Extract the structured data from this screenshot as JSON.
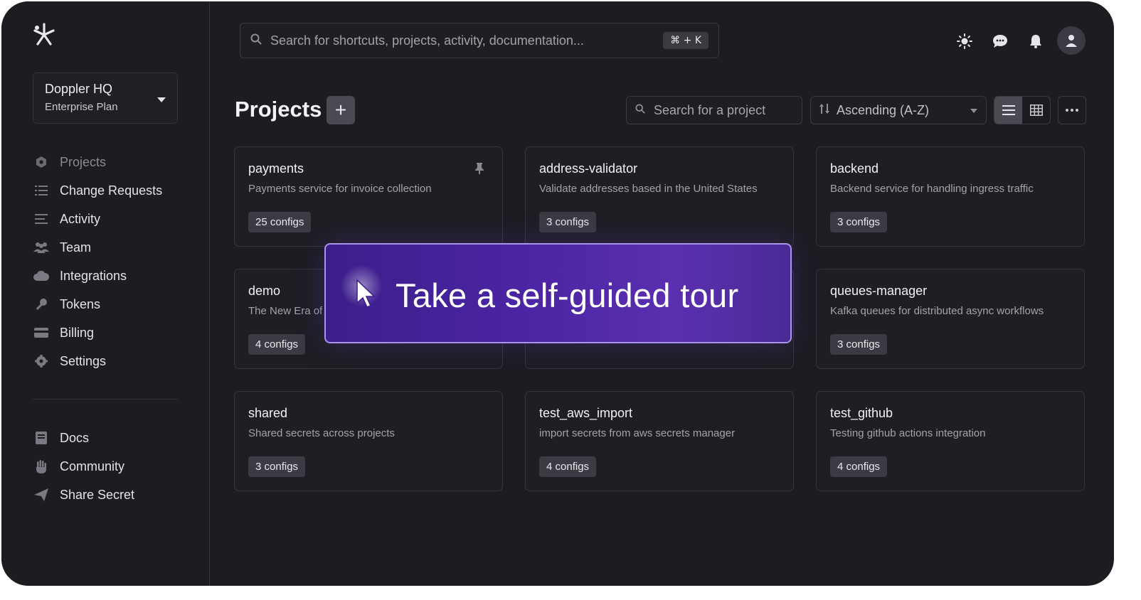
{
  "org": {
    "name": "Doppler HQ",
    "plan": "Enterprise Plan"
  },
  "sidebar": {
    "items": [
      {
        "label": "Projects",
        "icon": "hexagon-gear-icon"
      },
      {
        "label": "Change Requests",
        "icon": "list-check-icon"
      },
      {
        "label": "Activity",
        "icon": "lines-icon"
      },
      {
        "label": "Team",
        "icon": "users-icon"
      },
      {
        "label": "Integrations",
        "icon": "cloud-icon"
      },
      {
        "label": "Tokens",
        "icon": "key-icon"
      },
      {
        "label": "Billing",
        "icon": "credit-card-icon"
      },
      {
        "label": "Settings",
        "icon": "gear-icon"
      }
    ],
    "footer_items": [
      {
        "label": "Docs",
        "icon": "book-icon"
      },
      {
        "label": "Community",
        "icon": "hand-icon"
      },
      {
        "label": "Share Secret",
        "icon": "paper-plane-icon"
      }
    ]
  },
  "search": {
    "placeholder": "Search for shortcuts, projects, activity, documentation...",
    "shortcut": "⌘ + K"
  },
  "header": {
    "title": "Projects",
    "add_label": "+",
    "project_search_placeholder": "Search for a project",
    "sort_value": "Ascending (A-Z)"
  },
  "projects": [
    {
      "name": "payments",
      "description": "Payments service for invoice collection",
      "configs": "25 configs",
      "pinned": true
    },
    {
      "name": "address-validator",
      "description": "Validate addresses based in the United States",
      "configs": "3 configs"
    },
    {
      "name": "backend",
      "description": "Backend service for handling ingress traffic",
      "configs": "3 configs"
    },
    {
      "name": "demo",
      "description": "The New Era of",
      "configs": "4 configs"
    },
    {
      "name": "",
      "description": "",
      "configs": ""
    },
    {
      "name": "queues-manager",
      "description": "Kafka queues for distributed async workflows",
      "configs": "3 configs"
    },
    {
      "name": "shared",
      "description": "Shared secrets across projects",
      "configs": "3 configs"
    },
    {
      "name": "test_aws_import",
      "description": "import secrets from aws secrets manager",
      "configs": "4 configs"
    },
    {
      "name": "test_github",
      "description": "Testing github actions integration",
      "configs": "4 configs"
    }
  ],
  "tour": {
    "label": "Take a self-guided tour"
  },
  "colors": {
    "background": "#1c1c21",
    "card": "#1e1e23",
    "tour": "#4a24a2"
  }
}
